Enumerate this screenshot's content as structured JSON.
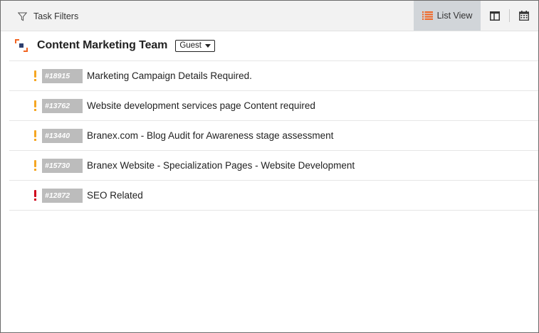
{
  "toolbar": {
    "filters_label": "Task Filters",
    "list_view_label": "List View",
    "accent_color": "#f26522"
  },
  "team": {
    "name": "Content Marketing Team",
    "role": "Guest"
  },
  "tasks": [
    {
      "id": "#18915",
      "title": "Marketing Campaign Details Required.",
      "priority": "medium",
      "priority_color": "#f5a623"
    },
    {
      "id": "#13762",
      "title": "Website development services page Content required",
      "priority": "medium",
      "priority_color": "#f5a623"
    },
    {
      "id": "#13440",
      "title": "Branex.com - Blog Audit for Awareness stage assessment",
      "priority": "medium",
      "priority_color": "#f5a623"
    },
    {
      "id": "#15730",
      "title": "Branex Website - Specialization Pages - Website Development",
      "priority": "medium",
      "priority_color": "#f5a623"
    },
    {
      "id": "#12872",
      "title": "SEO Related",
      "priority": "high",
      "priority_color": "#d0021b"
    }
  ]
}
